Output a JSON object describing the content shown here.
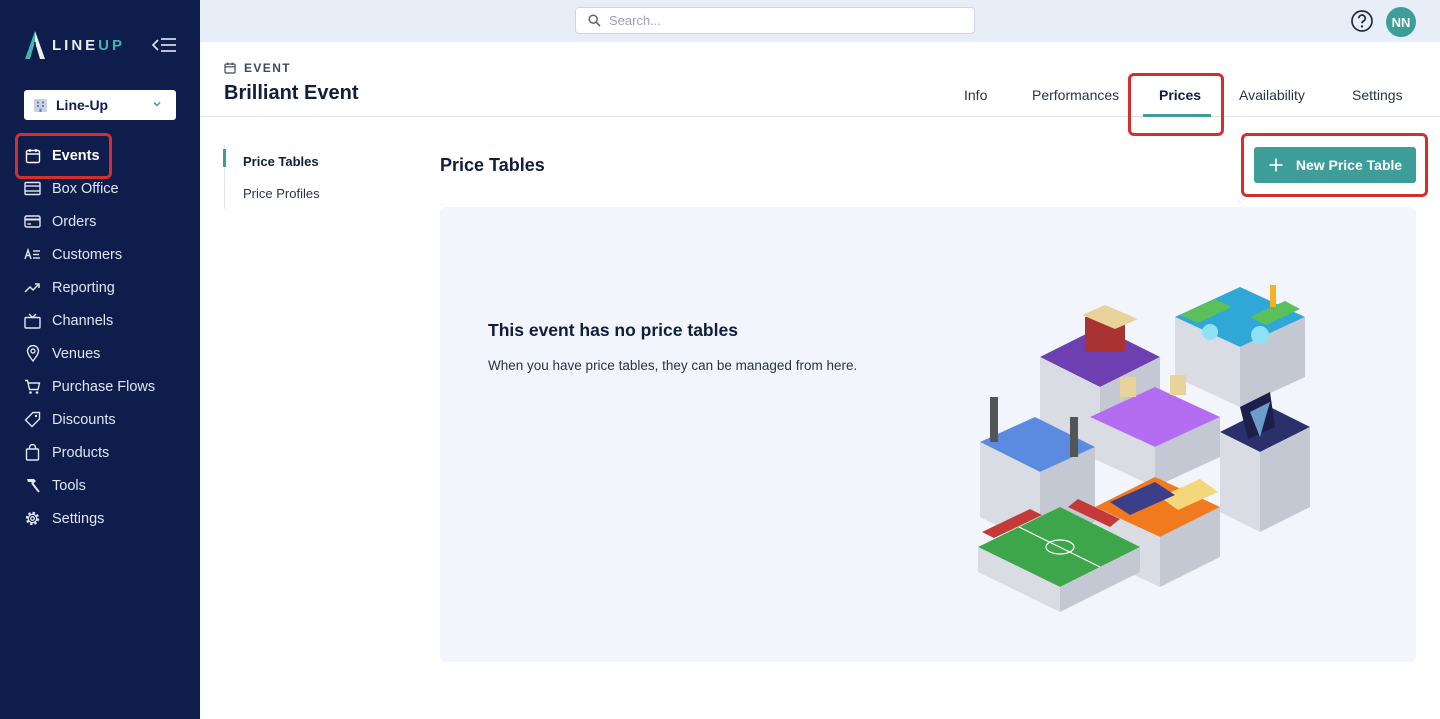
{
  "app": {
    "logo_line": "LINE",
    "logo_up": "UP"
  },
  "sidebar": {
    "org_name": "Line-Up",
    "items": [
      {
        "label": "Events",
        "icon": "calendar-icon",
        "active": true
      },
      {
        "label": "Box Office",
        "icon": "ticket-icon"
      },
      {
        "label": "Orders",
        "icon": "credit-card-icon"
      },
      {
        "label": "Customers",
        "icon": "contact-list-icon"
      },
      {
        "label": "Reporting",
        "icon": "trend-chart-icon"
      },
      {
        "label": "Channels",
        "icon": "tv-icon"
      },
      {
        "label": "Venues",
        "icon": "map-pin-icon"
      },
      {
        "label": "Purchase Flows",
        "icon": "cart-icon"
      },
      {
        "label": "Discounts",
        "icon": "tag-icon"
      },
      {
        "label": "Products",
        "icon": "shopping-bag-icon"
      },
      {
        "label": "Tools",
        "icon": "hammer-icon"
      },
      {
        "label": "Settings",
        "icon": "gear-icon"
      }
    ]
  },
  "topbar": {
    "search_placeholder": "Search...",
    "avatar_initials": "NN"
  },
  "header": {
    "eyebrow": "EVENT",
    "title": "Brilliant Event",
    "tabs": [
      {
        "label": "Info"
      },
      {
        "label": "Performances"
      },
      {
        "label": "Prices",
        "active": true
      },
      {
        "label": "Availability"
      },
      {
        "label": "Settings"
      }
    ]
  },
  "subnav": {
    "items": [
      {
        "label": "Price Tables",
        "active": true
      },
      {
        "label": "Price Profiles"
      }
    ]
  },
  "main": {
    "section_title": "Price Tables",
    "new_button_label": "New Price Table",
    "empty_title": "This event has no price tables",
    "empty_description": "When you have price tables, they can be managed from here."
  },
  "colors": {
    "sidebar_bg": "#0f1d4d",
    "accent": "#3d9e99",
    "highlight": "#d32f2f"
  }
}
